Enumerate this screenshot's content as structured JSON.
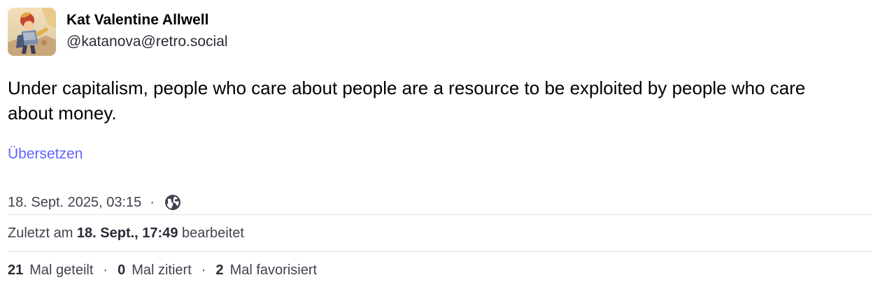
{
  "author": {
    "display_name": "Kat Valentine Allwell",
    "handle": "@katanova@retro.social"
  },
  "post": {
    "text": "Under capitalism, people who care about people are a resource to be exploited by people who care about money.",
    "translate_label": "Übersetzen",
    "timestamp": "18. Sept. 2025, 03:15",
    "separator": "·",
    "visibility_icon": "globe-icon"
  },
  "edited": {
    "prefix": "Zuletzt am",
    "date": "18. Sept., 17:49",
    "suffix": "bearbeitet"
  },
  "stats": {
    "reblogs_count": "21",
    "reblogs_label": "Mal geteilt",
    "quotes_count": "0",
    "quotes_label": "Mal zitiert",
    "favourites_count": "2",
    "favourites_label": "Mal favorisiert",
    "separator": "·"
  },
  "colors": {
    "link": "#6364ff",
    "secondary_text": "#40434f",
    "divider": "#e1e3ea"
  }
}
